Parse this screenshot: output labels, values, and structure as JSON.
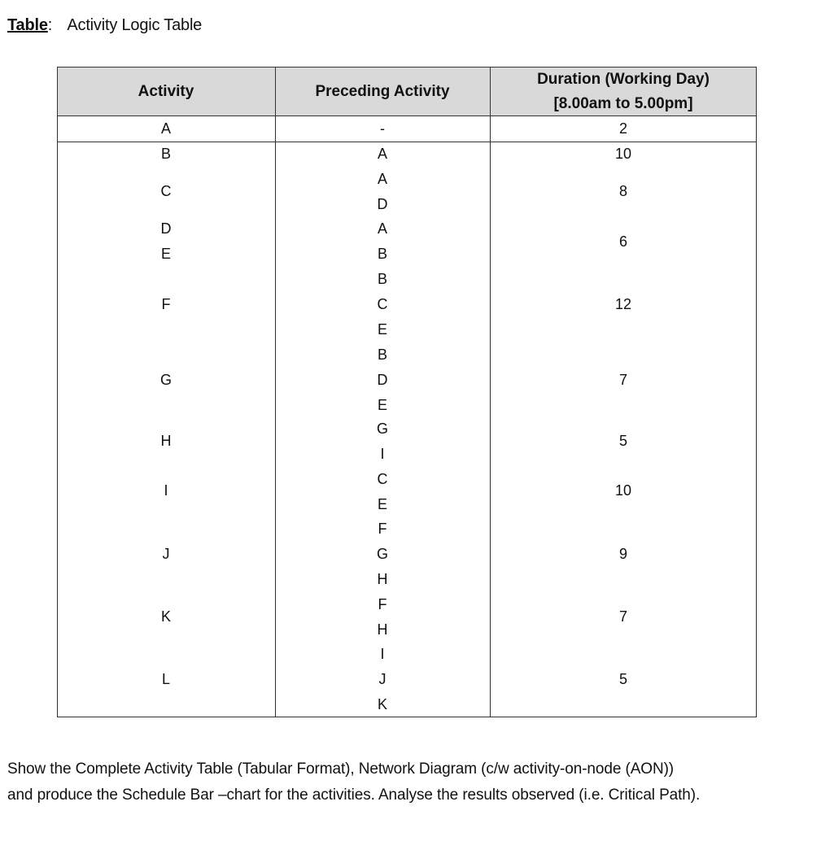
{
  "caption": {
    "label": "Table",
    "colon": ":",
    "title": "Activity Logic Table"
  },
  "table": {
    "headers": {
      "activity": "Activity",
      "preceding": "Preceding Activity",
      "duration_line1": "Duration (Working Day)",
      "duration_line2": "[8.00am to 5.00pm]"
    },
    "rows": [
      {
        "activity": "A",
        "preceding": [
          "-"
        ],
        "duration": "2"
      },
      {
        "activity": "B",
        "preceding": [
          "A"
        ],
        "duration": "10"
      },
      {
        "activity": "C",
        "preceding": [
          "A",
          "D"
        ],
        "duration": "8"
      },
      {
        "activity": "D",
        "preceding": [
          "A"
        ],
        "duration": "6"
      },
      {
        "activity": "E",
        "preceding": [
          "B"
        ],
        "duration": ""
      },
      {
        "activity": "F",
        "preceding": [
          "B",
          "C",
          "E"
        ],
        "duration": "12"
      },
      {
        "activity": "G",
        "preceding": [
          "B",
          "D",
          "E"
        ],
        "duration": "7"
      },
      {
        "activity": "H",
        "preceding": [
          "G",
          "I"
        ],
        "duration": "5"
      },
      {
        "activity": "I",
        "preceding": [
          "C",
          "E"
        ],
        "duration": "10"
      },
      {
        "activity": "J",
        "preceding": [
          "F",
          "G",
          "H"
        ],
        "duration": "9"
      },
      {
        "activity": "K",
        "preceding": [
          "F",
          "H"
        ],
        "duration": "7"
      },
      {
        "activity": "L",
        "preceding": [
          "I",
          "J",
          "K"
        ],
        "duration": "5"
      }
    ]
  },
  "instructions": {
    "line1": "Show the Complete Activity Table (Tabular Format), Network Diagram (c/w activity-on-node (AON))",
    "line2": "and produce the Schedule Bar –chart for the activities. Analyse the results observed (i.e. Critical Path)."
  }
}
